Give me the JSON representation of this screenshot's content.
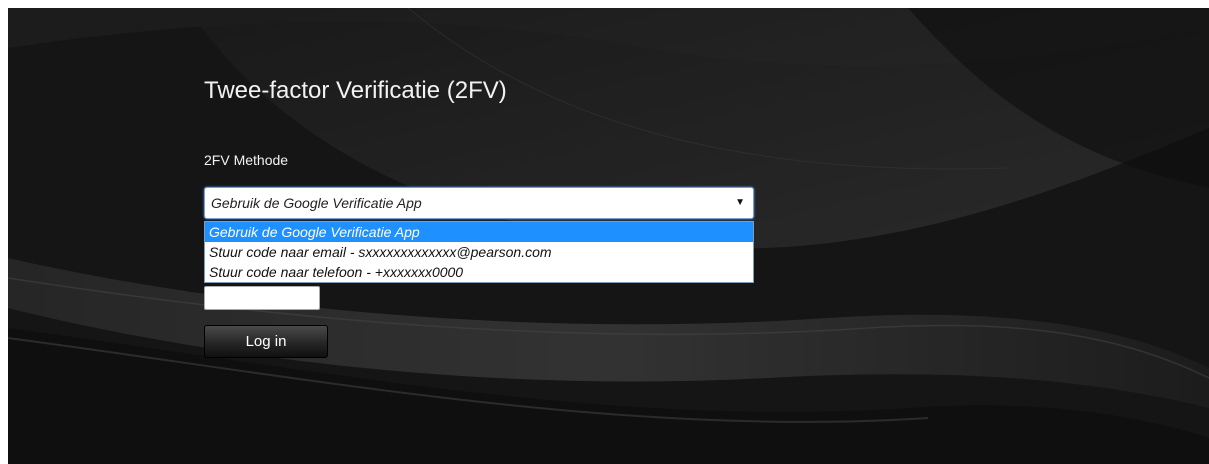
{
  "page": {
    "title": "Twee-factor Verificatie (2FV)"
  },
  "form": {
    "method_label": "2FV Methode",
    "method_select": {
      "selected": "Gebruik de Google Verificatie App",
      "arrow_icon": "dropdown-arrow-icon",
      "options": [
        "Gebruik de Google Verificatie App",
        "Stuur code naar email - sxxxxxxxxxxxxx@pearson.com",
        "Stuur code naar telefoon - +xxxxxxx0000"
      ],
      "highlighted_option_index": 0
    },
    "code_input": {
      "value": "",
      "placeholder": ""
    },
    "login_label": "Log in"
  },
  "colors": {
    "background": "#141414",
    "highlight": "#1e90ff",
    "text": "#f2f2f2"
  }
}
